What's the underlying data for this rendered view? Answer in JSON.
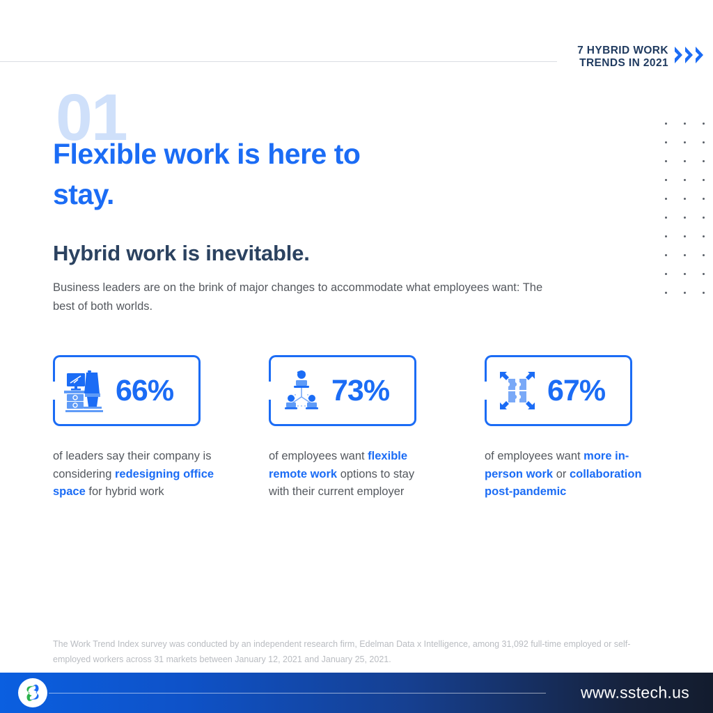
{
  "header": {
    "brand_line1": "7 HYBRID WORK",
    "brand_line2": "TRENDS IN 2021",
    "brand_text": "7 HYBRID WORK\nTRENDS IN 2021",
    "chevron_icon": "chevron-right-icon",
    "accent_color": "#1b6cf5",
    "navy_color": "#1f3a5f"
  },
  "hero": {
    "number": "01",
    "title": "Flexible work is here to stay.",
    "subtitle": "Hybrid work is inevitable.",
    "body": "Business leaders are on the brink of major changes to accommodate what employees want: The best of both worlds.",
    "number_color": "#cfe0fa",
    "title_color": "#1b6cf5",
    "subtitle_color": "#2b4260"
  },
  "stats": [
    {
      "percent": "66%",
      "icon": "desk-workstation-icon",
      "caption_parts": [
        {
          "text": "of leaders say their company is considering ",
          "highlight": false
        },
        {
          "text": "redesigning office space",
          "highlight": true
        },
        {
          "text": " for hybrid work",
          "highlight": false
        }
      ]
    },
    {
      "percent": "73%",
      "icon": "remote-team-network-icon",
      "caption_parts": [
        {
          "text": "of employees want ",
          "highlight": false
        },
        {
          "text": "flexible remote work",
          "highlight": true
        },
        {
          "text": " options to stay with their current employer",
          "highlight": false
        }
      ]
    },
    {
      "percent": "67%",
      "icon": "puzzle-expand-collaboration-icon",
      "caption_parts": [
        {
          "text": "of employees want ",
          "highlight": false
        },
        {
          "text": "more in-person work",
          "highlight": true
        },
        {
          "text": " or ",
          "highlight": false
        },
        {
          "text": "collaboration post-pandemic",
          "highlight": true
        }
      ]
    }
  ],
  "footnote": "The Work Trend Index survey was conducted by an independent research firm, Edelman Data x Intelligence, among 31,092 full-time employed or self-employed workers across 31 markets between January 12, 2021 and January 25, 2021.",
  "footer": {
    "url": "www.sstech.us",
    "logo_icon": "sstech-s-logo-icon"
  },
  "dot_grid": {
    "columns": 3,
    "rows": 10,
    "dot_color": "#5a5f68"
  }
}
